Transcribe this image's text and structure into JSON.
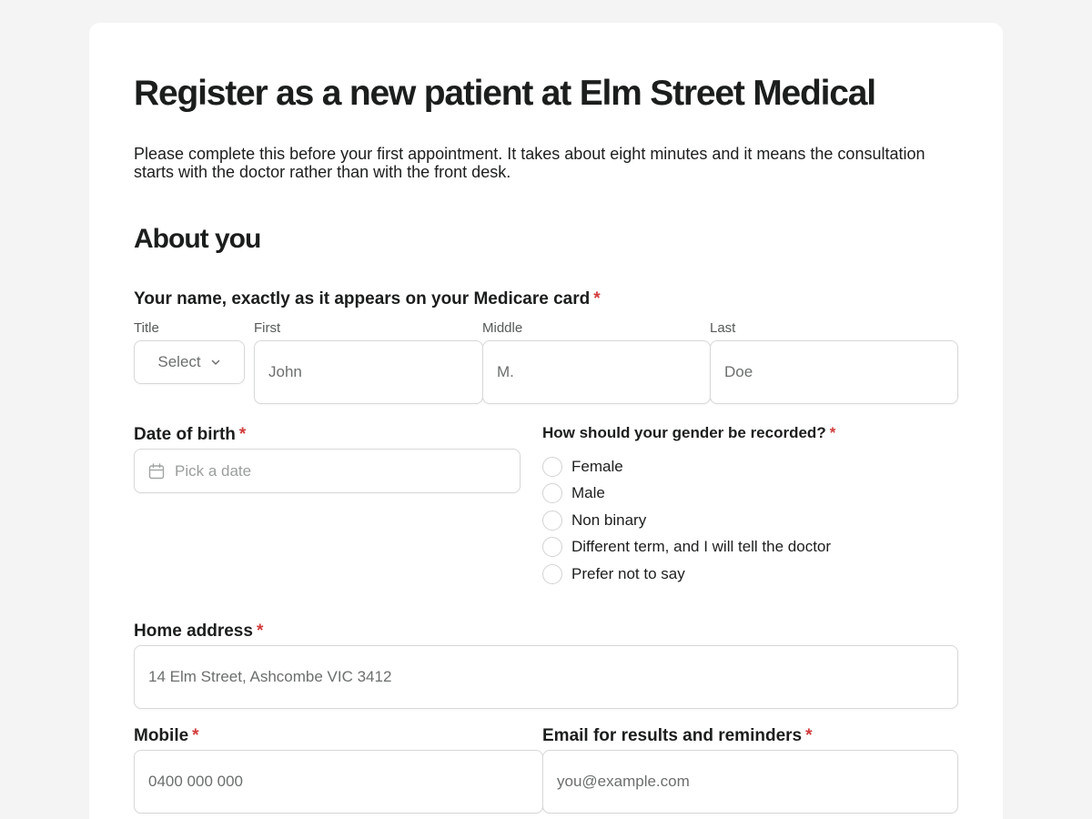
{
  "form": {
    "title": "Register as a new patient at Elm Street Medical",
    "intro": "Please complete this before your first appointment. It takes about eight minutes and it means the consultation starts with the doctor rather than with the front desk.",
    "section_about": "About you",
    "name": {
      "label": "Your name, exactly as it appears on your Medicare card",
      "required": "*",
      "title_label": "Title",
      "title_value": "Select",
      "first_label": "First",
      "first_placeholder": "John",
      "middle_label": "Middle",
      "middle_placeholder": "M.",
      "last_label": "Last",
      "last_placeholder": "Doe"
    },
    "dob": {
      "label": "Date of birth",
      "required": "*",
      "placeholder": "Pick a date"
    },
    "gender": {
      "label": "How should your gender be recorded?",
      "required": "*",
      "options": [
        "Female",
        "Male",
        "Non binary",
        "Different term, and I will tell the doctor",
        "Prefer not to say"
      ]
    },
    "address": {
      "label": "Home address",
      "required": "*",
      "placeholder": "14 Elm Street, Ashcombe VIC 3412"
    },
    "mobile": {
      "label": "Mobile",
      "required": "*",
      "placeholder": "0400 000 000"
    },
    "email": {
      "label": "Email for results and reminders",
      "required": "*",
      "placeholder": "you@example.com"
    }
  }
}
